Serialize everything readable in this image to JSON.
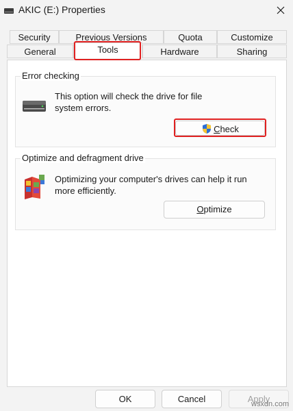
{
  "window": {
    "title": "AKIC (E:) Properties",
    "drive_icon": "drive-icon",
    "close_icon": "close-icon"
  },
  "tabs": {
    "row_top": [
      "Security",
      "Previous Versions",
      "Quota",
      "Customize"
    ],
    "row_bottom": [
      "General",
      "Tools",
      "Hardware",
      "Sharing"
    ],
    "selected": "Tools"
  },
  "error_checking": {
    "title": "Error checking",
    "description_line1": "This option will check the drive for file",
    "description_line2": "system errors.",
    "button_mnemonic": "C",
    "button_rest": "heck",
    "button_icon": "uac-shield-icon",
    "icon": "hard-drive-icon"
  },
  "optimize": {
    "title": "Optimize and defragment drive",
    "description_line1": "Optimizing your computer's drives can help it run",
    "description_line2": "more efficiently.",
    "button_mnemonic": "O",
    "button_rest": "ptimize",
    "icon": "defrag-icon"
  },
  "footer": {
    "ok": "OK",
    "cancel": "Cancel",
    "apply": "Apply",
    "apply_enabled": false
  },
  "watermark": "wsxdn.com",
  "colors": {
    "highlight": "#e02020",
    "window_bg": "#f3f3f3",
    "panel_bg": "#ffffff"
  }
}
